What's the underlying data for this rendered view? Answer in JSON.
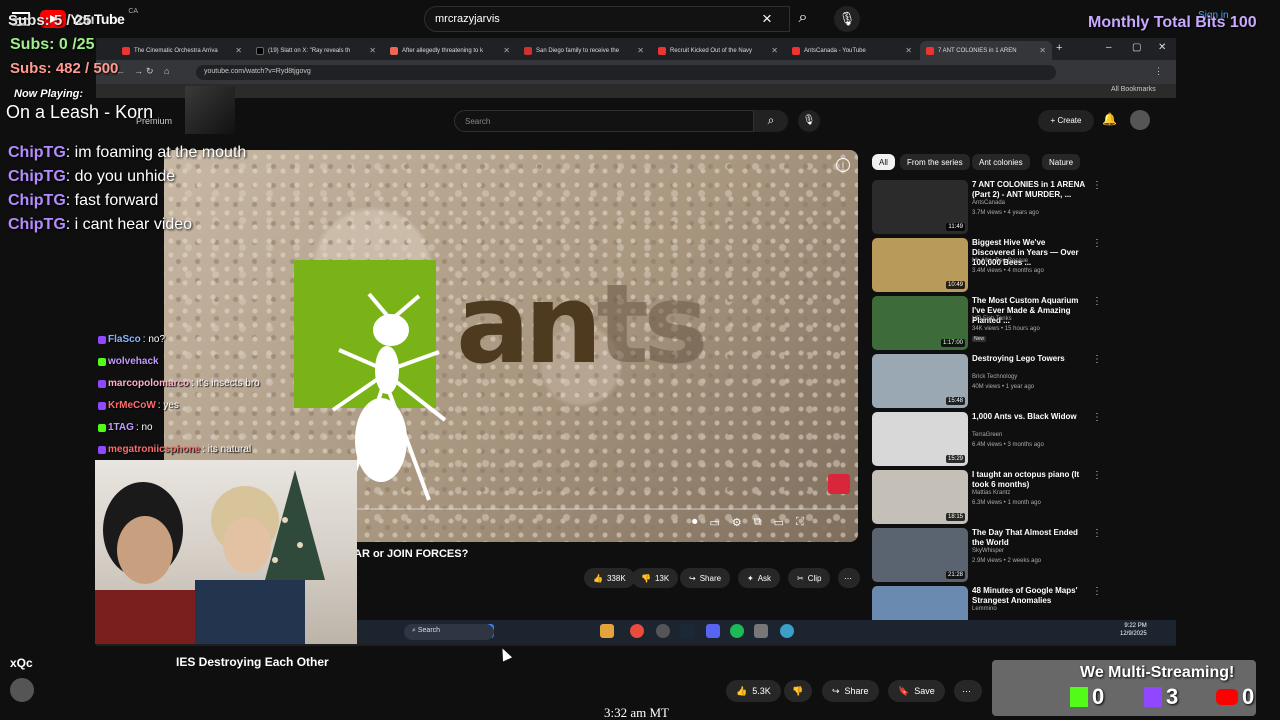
{
  "outer": {
    "brand": "YouTube",
    "region": "CA",
    "search_value": "mrcrazyjarvis",
    "signin": "Sign in"
  },
  "overlays": {
    "subs_a": "Subs: 5 / 25",
    "subs_b": "Subs: 0 /25",
    "subs_c": "Subs: 482 / 500",
    "monthly": "Monthly Total Bits 100",
    "now_playing_label": "Now Playing:",
    "now_playing_song": "On a Leash - Korn"
  },
  "chat": [
    {
      "user": "ChipTG",
      "msg": "im foaming at the mouth"
    },
    {
      "user": "ChipTG",
      "msg": "do you unhide"
    },
    {
      "user": "ChipTG",
      "msg": "fast forward"
    },
    {
      "user": "ChipTG",
      "msg": "i cant hear video"
    }
  ],
  "mini_chat": [
    {
      "user": "FlaSco",
      "msg": ": no?"
    },
    {
      "user": "wolvehack",
      "msg": ""
    },
    {
      "user": "marcopolomarco",
      "msg": ": it's insects bro"
    },
    {
      "user": "KrMeCoW",
      "msg": ": yes"
    },
    {
      "user": "1TAG",
      "msg": ": no"
    },
    {
      "user": "megatroniicsphone",
      "msg": ": its natural"
    }
  ],
  "browser": {
    "tabs": [
      "The Cinematic Orchestra Arriva",
      "(19) Slatt on X: \"Ray reveals th",
      "After allegedly threatening to k",
      "San Diego family to receive the",
      "Recruit Kicked Out of the Navy",
      "AntsCanada - YouTube",
      "7 ANT COLONIES in 1 AREN"
    ],
    "url": "youtube.com/watch?v=Ryd8tjgovg",
    "bookmarks": "All Bookmarks"
  },
  "inner": {
    "premium": "Premium",
    "search_placeholder": "Search",
    "create": "Create",
    "video_title": "AR or JOIN FORCES?",
    "likes": "338K",
    "dislikes": "13K",
    "share": "Share",
    "ask": "Ask",
    "clip": "Clip",
    "logo_text": "an",
    "logo_fade": "ts"
  },
  "chips": [
    "All",
    "From the series",
    "Ant colonies",
    "Nature"
  ],
  "recommendations": [
    {
      "title": "7 ANT COLONIES in 1 ARENA (Part 2) - ANT MURDER, ...",
      "channel": "AntsCanada",
      "meta": "3.7M views • 4 years ago",
      "dur": "11:49",
      "badge": "",
      "color": "#2b2b2b"
    },
    {
      "title": "Biggest Hive We've Discovered in Years — Over 100,000 Bees ...",
      "channel": "Mr. Mrs. Bee Rescue",
      "meta": "3.4M views • 4 months ago",
      "dur": "10:49",
      "badge": "",
      "color": "#b89a5a"
    },
    {
      "title": "The Most Custom Aquarium I've Ever Made & Amazing Planted ...",
      "channel": "MD Fish Tanks",
      "meta": "34K views • 15 hours ago",
      "dur": "1:17:00",
      "badge": "New",
      "color": "#3e6b3a"
    },
    {
      "title": "Destroying Lego Towers",
      "channel": "Brick Technology",
      "meta": "40M views • 1 year ago",
      "dur": "15:48",
      "badge": "",
      "color": "#9aa8b4"
    },
    {
      "title": "1,000 Ants vs. Black Widow",
      "channel": "TerraGreen",
      "meta": "6.4M views • 3 months ago",
      "dur": "15:29",
      "badge": "",
      "color": "#d8d8d8"
    },
    {
      "title": "I taught an octopus piano (It took 6 months)",
      "channel": "Mattias Krantz",
      "meta": "6.3M views • 1 month ago",
      "dur": "18:15",
      "badge": "",
      "color": "#c4c0b8"
    },
    {
      "title": "The Day That Almost Ended the World",
      "channel": "SkyWhisper",
      "meta": "2.9M views • 2 weeks ago",
      "dur": "21:28",
      "badge": "",
      "color": "#5a6470"
    },
    {
      "title": "48 Minutes of Google Maps' Strangest Anomalies",
      "channel": "Lemmino",
      "meta": "",
      "dur": "",
      "badge": "",
      "color": "#6a8ab0"
    }
  ],
  "taskbar": {
    "search": "Search",
    "time": "9:22 PM",
    "date": "12/9/2025"
  },
  "bottom": {
    "streamer": "xQc",
    "title": "IES Destroying Each Other",
    "likes": "5.3K",
    "share": "Share",
    "save": "Save",
    "clock": "3:32 am MT"
  },
  "multistream": {
    "title": "We Multi-Streaming!",
    "kick": "0",
    "twitch": "3",
    "youtube": "0"
  },
  "colors": {
    "kick": "#53fc18",
    "twitch": "#9146ff",
    "youtube": "#ff0000",
    "chat_user": "#b38cff"
  }
}
